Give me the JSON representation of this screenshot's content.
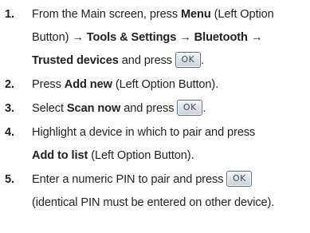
{
  "steps": [
    {
      "number": "1.",
      "line1": {
        "pre": "From the Main screen, press ",
        "menu": "Menu",
        "post": " (Left Option"
      },
      "line2": {
        "pre": "Button) ",
        "arrow1": "→",
        "tools": "Tools & Settings",
        "arrow2": "→",
        "bluetooth": "Bluetooth",
        "arrow3": "→"
      },
      "line3": {
        "trusted": "Trusted devices",
        "post": " and press "
      },
      "ok_key": "OK",
      "end": "."
    },
    {
      "number": "2.",
      "pre": "Press ",
      "bold": "Add new",
      "post": " (Left Option Button)."
    },
    {
      "number": "3.",
      "pre": "Select ",
      "bold": "Scan now",
      "post": " and press ",
      "ok_key": "OK",
      "end": "."
    },
    {
      "number": "4.",
      "line1": "Highlight a device in which to pair and press",
      "line2": {
        "bold": "Add to list",
        "post": " (Left Option Button)."
      }
    },
    {
      "number": "5.",
      "line1": {
        "pre": "Enter a numeric PIN to pair and press ",
        "ok_key": "OK"
      },
      "line2": "(identical PIN must be entered on other device)."
    }
  ]
}
